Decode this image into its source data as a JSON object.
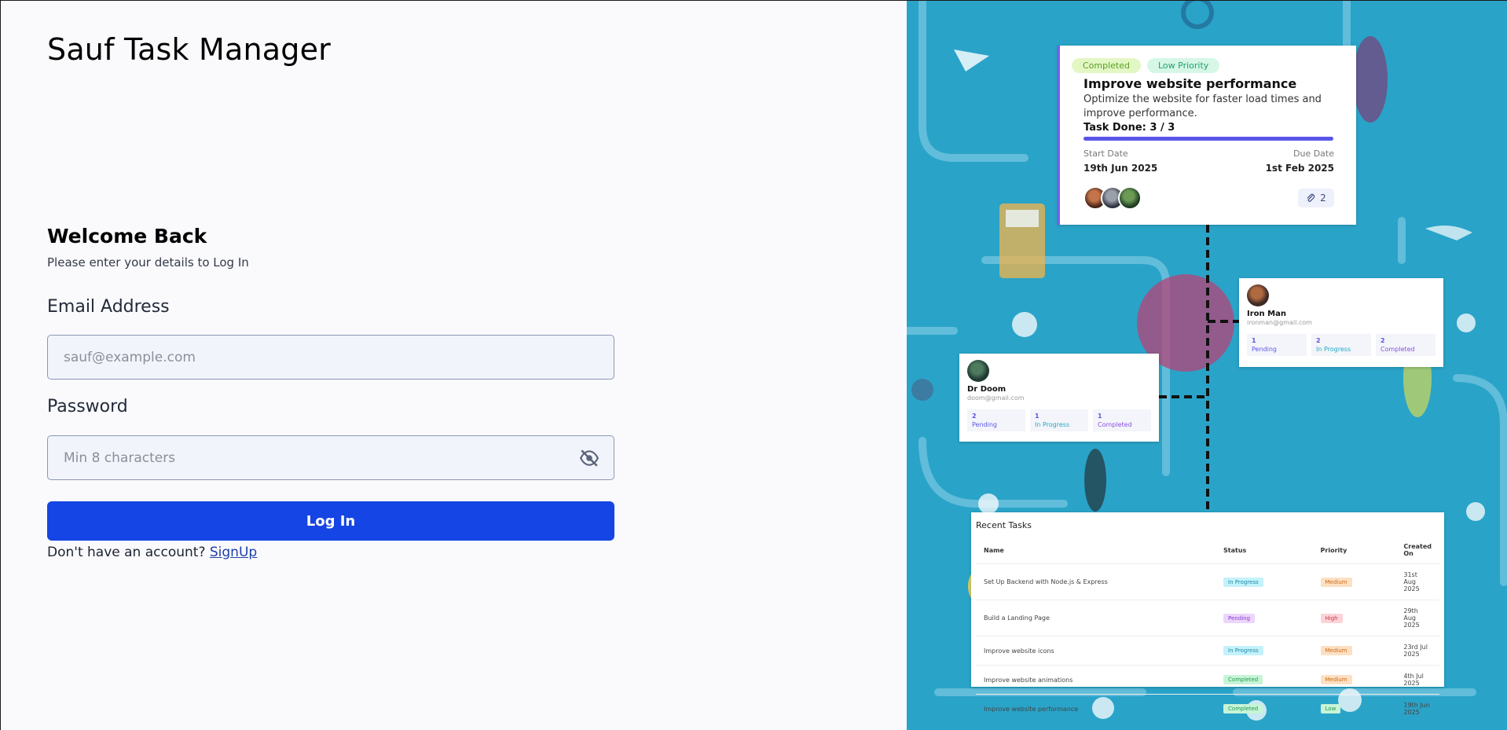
{
  "app": {
    "title": "Sauf Task Manager"
  },
  "login": {
    "heading": "Welcome Back",
    "subheading": "Please enter your details to Log In",
    "email_label": "Email Address",
    "email_placeholder": "sauf@example.com",
    "email_value": "",
    "password_label": "Password",
    "password_placeholder": "Min 8 characters",
    "password_value": "",
    "submit_label": "Log In",
    "signup_prompt": "Don't have an account? ",
    "signup_link": "SignUp"
  },
  "colors": {
    "primary": "#1545e4",
    "illustration_bg": "#2aa3c8",
    "accent_purple": "#5a55e8"
  },
  "icons": {
    "password_toggle": "eye-off-icon",
    "attachment": "paperclip-icon"
  },
  "illustration": {
    "task_card": {
      "status_badge": "Completed",
      "priority_badge": "Low Priority",
      "title": "Improve website performance",
      "description": "Optimize the website for faster load times and improve performance.",
      "progress_label": "Task Done: 3 / 3",
      "progress_fraction": 1.0,
      "start_label": "Start Date",
      "start_value": "19th Jun 2025",
      "due_label": "Due Date",
      "due_value": "1st Feb 2025",
      "attachments": "2"
    },
    "users": [
      {
        "name": "Iron Man",
        "email": "ironman@gmail.com",
        "stats": [
          {
            "count": "1",
            "label": "Pending"
          },
          {
            "count": "2",
            "label": "In Progress"
          },
          {
            "count": "2",
            "label": "Completed"
          }
        ]
      },
      {
        "name": "Dr Doom",
        "email": "doom@gmail.com",
        "stats": [
          {
            "count": "2",
            "label": "Pending"
          },
          {
            "count": "1",
            "label": "In Progress"
          },
          {
            "count": "1",
            "label": "Completed"
          }
        ]
      }
    ],
    "recent_tasks": {
      "title": "Recent Tasks",
      "columns": [
        "Name",
        "Status",
        "Priority",
        "Created On"
      ],
      "rows": [
        {
          "name": "Set Up Backend with Node.js & Express",
          "status": "In Progress",
          "priority": "Medium",
          "created": "31st Aug 2025"
        },
        {
          "name": "Build a Landing Page",
          "status": "Pending",
          "priority": "High",
          "created": "29th Aug 2025"
        },
        {
          "name": "Improve website icons",
          "status": "In Progress",
          "priority": "Medium",
          "created": "23rd Jul 2025"
        },
        {
          "name": "Improve website animations",
          "status": "Completed",
          "priority": "Medium",
          "created": "4th Jul 2025"
        },
        {
          "name": "Improve website performance",
          "status": "Completed",
          "priority": "Low",
          "created": "19th Jun 2025"
        }
      ]
    }
  }
}
